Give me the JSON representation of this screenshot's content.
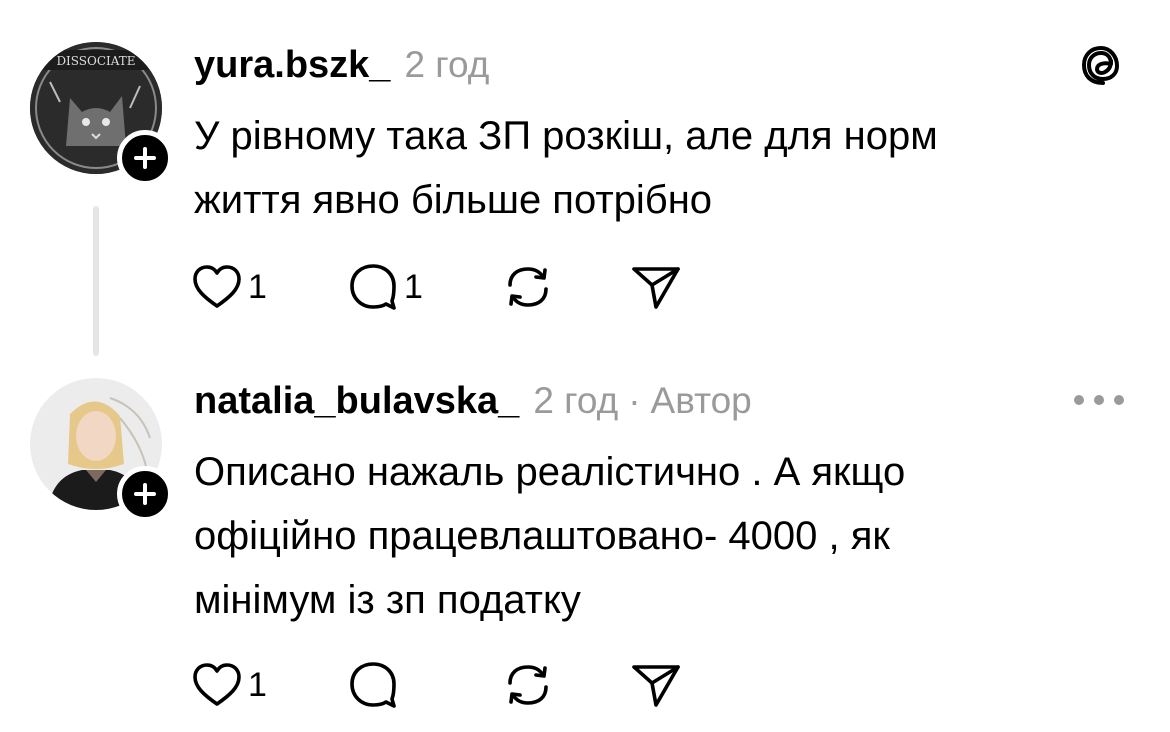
{
  "threads_logo_icon": "threads-logo-icon",
  "posts": [
    {
      "username": "yura.bszk_",
      "time": "2 год",
      "avatar_text": "DISSOCIATE",
      "text_lines": [
        "У рівному така ЗП розкіш, але для норм",
        "життя явно більше потрібно"
      ],
      "likes": "1",
      "replies": "1"
    },
    {
      "username": "natalia_bulavska_",
      "time": "2 год",
      "separator": "·",
      "author_label": "Автор",
      "text_lines": [
        "Описано нажаль реалістично . А якщо",
        "офіційно працевлаштовано- 4000 , як",
        "мінімум із зп податку"
      ],
      "likes": "1"
    }
  ],
  "colors": {
    "meta_gray": "#9a9a9a",
    "thread_line": "#e5e5e5"
  }
}
